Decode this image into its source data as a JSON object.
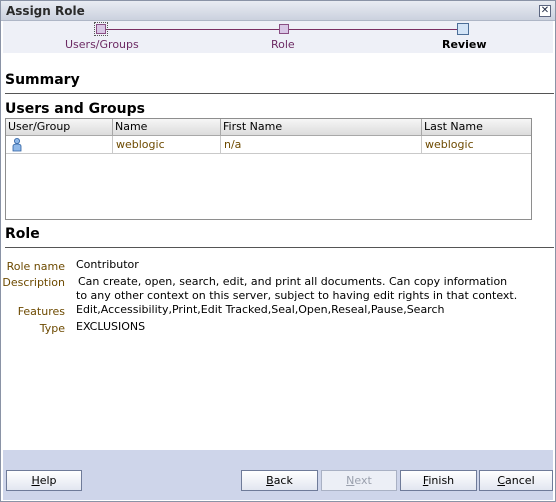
{
  "window": {
    "title": "Assign Role"
  },
  "train": {
    "steps": [
      {
        "label": "Users/Groups",
        "state": "visited"
      },
      {
        "label": "Role",
        "state": "normal"
      },
      {
        "label": "Review",
        "state": "current"
      }
    ]
  },
  "summary": {
    "heading": "Summary"
  },
  "users_groups": {
    "heading": "Users and Groups",
    "columns": [
      "User/Group",
      "Name",
      "First Name",
      "Last Name"
    ],
    "rows": [
      {
        "icon": "user-icon",
        "name": "weblogic",
        "first_name": "n/a",
        "last_name": "weblogic"
      }
    ]
  },
  "role": {
    "heading": "Role",
    "fields": [
      {
        "label": "Role name",
        "value": "Contributor"
      },
      {
        "label": "Description",
        "value": "Can create, open, search, edit, and print all documents. Can copy information to any other context on this server, subject to having edit rights in that context."
      },
      {
        "label": "Features",
        "value": "Edit,Accessibility,Print,Edit Tracked,Seal,Open,Reseal,Pause,Search"
      },
      {
        "label": "Type",
        "value": "EXCLUSIONS"
      }
    ]
  },
  "buttons": {
    "help": {
      "label": "Help",
      "mnemonic": "H",
      "rest": "elp"
    },
    "back": {
      "label": "Back",
      "mnemonic": "B",
      "rest": "ack"
    },
    "next": {
      "label": "Next",
      "mnemonic": "N",
      "rest": "ext"
    },
    "finish": {
      "label": "Finish",
      "mnemonic": "F",
      "rest": "inish"
    },
    "cancel": {
      "label": "Cancel",
      "mnemonic": "C",
      "rest": "ancel"
    }
  },
  "colors": {
    "train_link": "#6c2a63",
    "field_label": "#6d4a00",
    "footer_bg": "#ced5ea"
  }
}
